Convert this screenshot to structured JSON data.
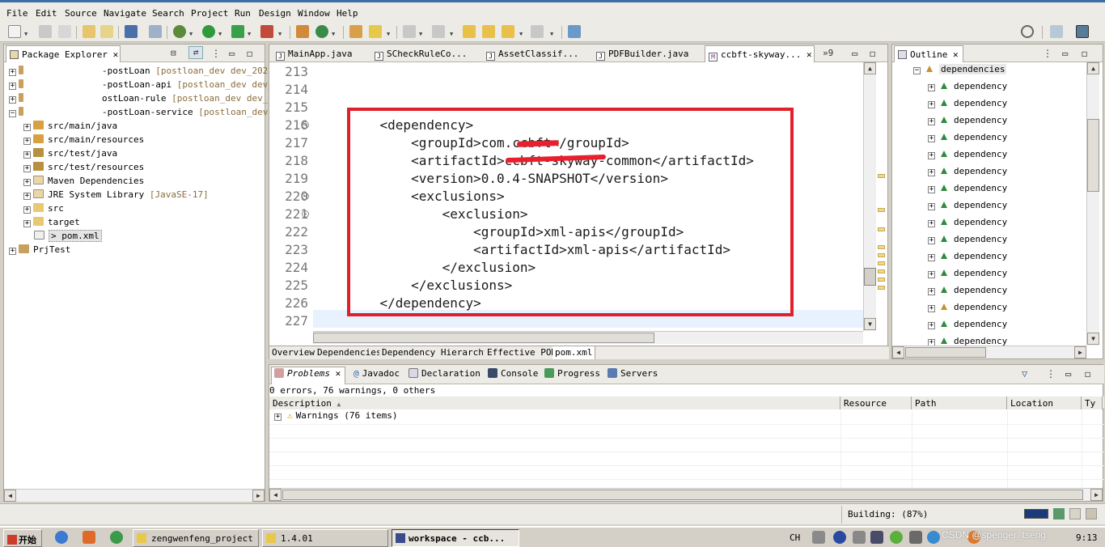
{
  "menu": [
    "File",
    "Edit",
    "Source",
    "Navigate",
    "Search",
    "Project",
    "Run",
    "Design",
    "Window",
    "Help"
  ],
  "package_explorer": {
    "title": "Package Explorer",
    "projects": [
      {
        "name": "-postLoan",
        "deco": "[postloan_dev dev_20230"
      },
      {
        "name": "-postLoan-api",
        "deco": "[postloan_dev dev_202"
      },
      {
        "name": "ostLoan-rule",
        "deco": "[postloan_dev dev_20"
      },
      {
        "name": "-postLoan-service",
        "deco": "[postloan_dev d"
      }
    ],
    "children": [
      {
        "name": "src/main/java",
        "deco": ""
      },
      {
        "name": "src/main/resources",
        "deco": ""
      },
      {
        "name": "src/test/java",
        "deco": ""
      },
      {
        "name": "src/test/resources",
        "deco": ""
      },
      {
        "name": "Maven Dependencies",
        "deco": ""
      },
      {
        "name": "JRE System Library",
        "deco": "[JavaSE-17]"
      },
      {
        "name": "src",
        "deco": ""
      },
      {
        "name": "target",
        "deco": ""
      },
      {
        "name": "> pom.xml",
        "deco": ""
      }
    ],
    "other_project": "PrjTest"
  },
  "editor": {
    "tabs": [
      "MainApp.java",
      "SCheckRuleCo...",
      "AssetClassif...",
      "PDFBuilder.java",
      "ccbft-skyway..."
    ],
    "overflow": "»9",
    "bottom_tabs": [
      "Overview",
      "Dependencies",
      "Dependency Hierarchy",
      "Effective POM",
      "pom.xml"
    ],
    "lines": [
      {
        "no": "213",
        "text": ""
      },
      {
        "no": "214",
        "text": ""
      },
      {
        "no": "215",
        "text": ""
      },
      {
        "no": "216",
        "text": "    <dependency>"
      },
      {
        "no": "217",
        "text": "        <groupId>com.ccbft</groupId>"
      },
      {
        "no": "218",
        "text": "        <artifactId>ccbft-skyway-common</artifactId>"
      },
      {
        "no": "219",
        "text": "        <version>0.0.4-SNAPSHOT</version>"
      },
      {
        "no": "220",
        "text": "        <exclusions>"
      },
      {
        "no": "221",
        "text": "            <exclusion>"
      },
      {
        "no": "222",
        "text": "                <groupId>xml-apis</groupId>"
      },
      {
        "no": "223",
        "text": "                <artifactId>xml-apis</artifactId>"
      },
      {
        "no": "224",
        "text": "            </exclusion>"
      },
      {
        "no": "225",
        "text": "        </exclusions>"
      },
      {
        "no": "226",
        "text": "    </dependency>"
      },
      {
        "no": "227",
        "text": ""
      }
    ]
  },
  "outline": {
    "title": "Outline",
    "root": "dependencies",
    "items": [
      "dependency",
      "dependency",
      "dependency",
      "dependency",
      "dependency",
      "dependency",
      "dependency",
      "dependency",
      "dependency",
      "dependency",
      "dependency",
      "dependency",
      "dependency",
      "dependency",
      "dependency",
      "dependency"
    ]
  },
  "problems": {
    "tabs": [
      "Problems",
      "Javadoc",
      "Declaration",
      "Console",
      "Progress",
      "Servers"
    ],
    "summary": "0 errors, 76 warnings, 0 others",
    "columns": [
      "Description",
      "Resource",
      "Path",
      "Location",
      "Ty"
    ],
    "rows": [
      {
        "description": "Warnings (76 items)"
      }
    ]
  },
  "status": {
    "building": "Building: (87%)"
  },
  "taskbar": {
    "start": "开始",
    "buttons": [
      "zengwenfeng_project",
      "1.4.01",
      "workspace - ccb..."
    ],
    "lang": "CH",
    "clock": "9:13",
    "watermark": "CSDN @spenger_tseng"
  },
  "colors": {
    "highlight_box": "#e0202a",
    "redaction": "#e8202e"
  }
}
